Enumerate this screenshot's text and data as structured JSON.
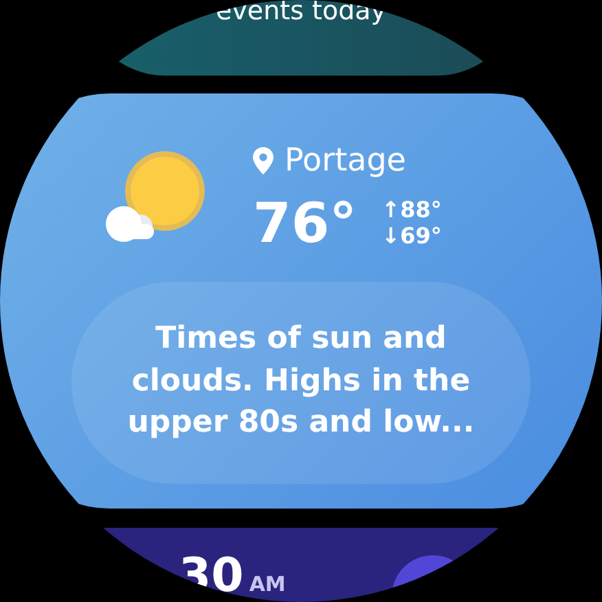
{
  "top_card": {
    "text": "events today"
  },
  "weather": {
    "location": "Portage",
    "temperature": "76°",
    "high": "↑88°",
    "low": "↓69°",
    "summary": "Times of sun and clouds. Highs in the upper 80s and low..."
  },
  "bottom_card": {
    "time": "30",
    "period": "AM"
  }
}
